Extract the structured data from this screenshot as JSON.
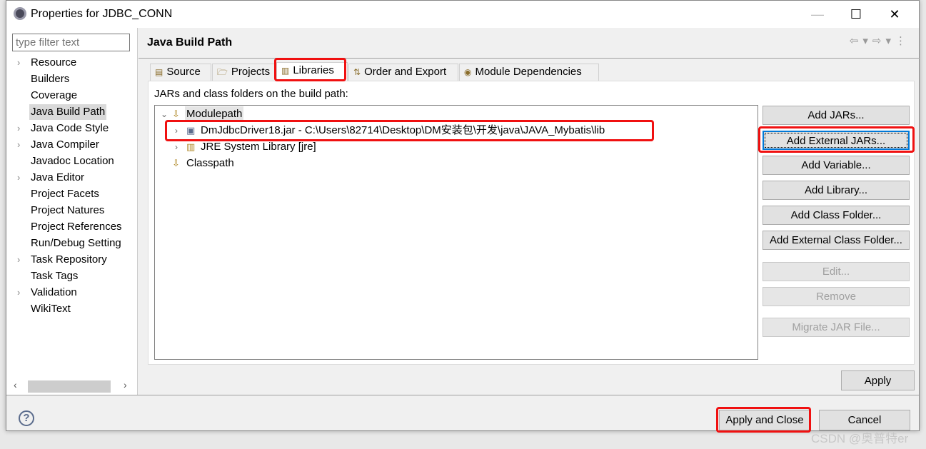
{
  "window": {
    "title": "Properties for JDBC_CONN",
    "minimize": "—",
    "maximize": "☐",
    "close": "✕"
  },
  "filter": {
    "placeholder": "type filter text"
  },
  "nav": [
    {
      "label": "Resource",
      "expandable": true
    },
    {
      "label": "Builders",
      "expandable": false
    },
    {
      "label": "Coverage",
      "expandable": false
    },
    {
      "label": "Java Build Path",
      "expandable": false,
      "selected": true
    },
    {
      "label": "Java Code Style",
      "expandable": true
    },
    {
      "label": "Java Compiler",
      "expandable": true
    },
    {
      "label": "Javadoc Location",
      "expandable": false
    },
    {
      "label": "Java Editor",
      "expandable": true
    },
    {
      "label": "Project Facets",
      "expandable": false
    },
    {
      "label": "Project Natures",
      "expandable": false
    },
    {
      "label": "Project References",
      "expandable": false
    },
    {
      "label": "Run/Debug Setting",
      "expandable": false
    },
    {
      "label": "Task Repository",
      "expandable": true
    },
    {
      "label": "Task Tags",
      "expandable": false
    },
    {
      "label": "Validation",
      "expandable": true
    },
    {
      "label": "WikiText",
      "expandable": false
    }
  ],
  "page": {
    "title": "Java Build Path"
  },
  "tabs": [
    {
      "label": "Source"
    },
    {
      "label": "Projects"
    },
    {
      "label": "Libraries",
      "active": true
    },
    {
      "label": "Order and Export"
    },
    {
      "label": "Module Dependencies"
    }
  ],
  "libraries": {
    "label": "JARs and class folders on the build path:",
    "tree": [
      {
        "label": "Modulepath",
        "level": 0,
        "expanded": true
      },
      {
        "label": "DmJdbcDriver18.jar - C:\\Users\\82714\\Desktop\\DM安装包\\开发\\java\\JAVA_Mybatis\\lib",
        "level": 1
      },
      {
        "label": "JRE System Library [jre]",
        "level": 1
      },
      {
        "label": "Classpath",
        "level": 0
      }
    ],
    "buttons": [
      {
        "label": "Add JARs...",
        "enabled": true
      },
      {
        "label": "Add External JARs...",
        "enabled": true,
        "focused": true
      },
      {
        "label": "Add Variable...",
        "enabled": true
      },
      {
        "label": "Add Library...",
        "enabled": true
      },
      {
        "label": "Add Class Folder...",
        "enabled": true
      },
      {
        "label": "Add External Class Folder...",
        "enabled": true
      },
      {
        "label": "Edit...",
        "enabled": false
      },
      {
        "label": "Remove",
        "enabled": false
      },
      {
        "label": "Migrate JAR File...",
        "enabled": false
      }
    ]
  },
  "footer": {
    "apply": "Apply",
    "apply_close": "Apply and Close",
    "cancel": "Cancel",
    "help": "?"
  },
  "watermark": "CSDN @奥普特er",
  "colors": {
    "highlight": "#f01010",
    "focus": "#0078d7"
  }
}
